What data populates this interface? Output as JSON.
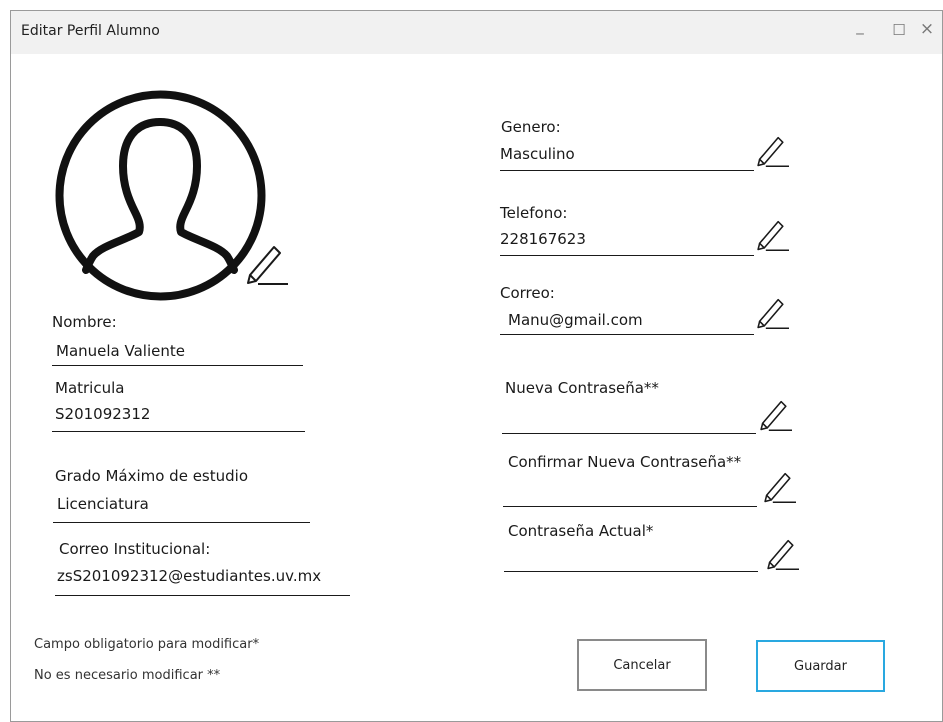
{
  "window": {
    "title": "Editar Perfil Alumno",
    "minimize": "_",
    "maximize": "☐",
    "close": "×"
  },
  "left": {
    "nombre": {
      "label": "Nombre:",
      "value": "Manuela Valiente"
    },
    "matricula": {
      "label": "Matricula",
      "value": "S201092312"
    },
    "grado": {
      "label": "Grado Máximo de estudio",
      "value": "Licenciatura"
    },
    "correo_institucional": {
      "label": "Correo Institucional:",
      "value": "zsS201092312@estudiantes.uv.mx"
    }
  },
  "right": {
    "genero": {
      "label": "Genero:",
      "value": "Masculino"
    },
    "telefono": {
      "label": "Telefono:",
      "value": "228167623"
    },
    "correo": {
      "label": "Correo:",
      "value": "Manu@gmail.com"
    },
    "nueva_contrasena": {
      "label": "Nueva Contraseña**",
      "value": ""
    },
    "confirmar_contrasena": {
      "label": "Confirmar Nueva Contraseña**",
      "value": ""
    },
    "contrasena_actual": {
      "label": "Contraseña Actual*",
      "value": ""
    }
  },
  "notes": {
    "required": "Campo obligatorio para modificar*",
    "optional": "No es necesario modificar **"
  },
  "buttons": {
    "cancel": "Cancelar",
    "save": "Guardar"
  },
  "colors": {
    "save_border": "#29a8e0",
    "cancel_border": "#8a8a8a"
  }
}
